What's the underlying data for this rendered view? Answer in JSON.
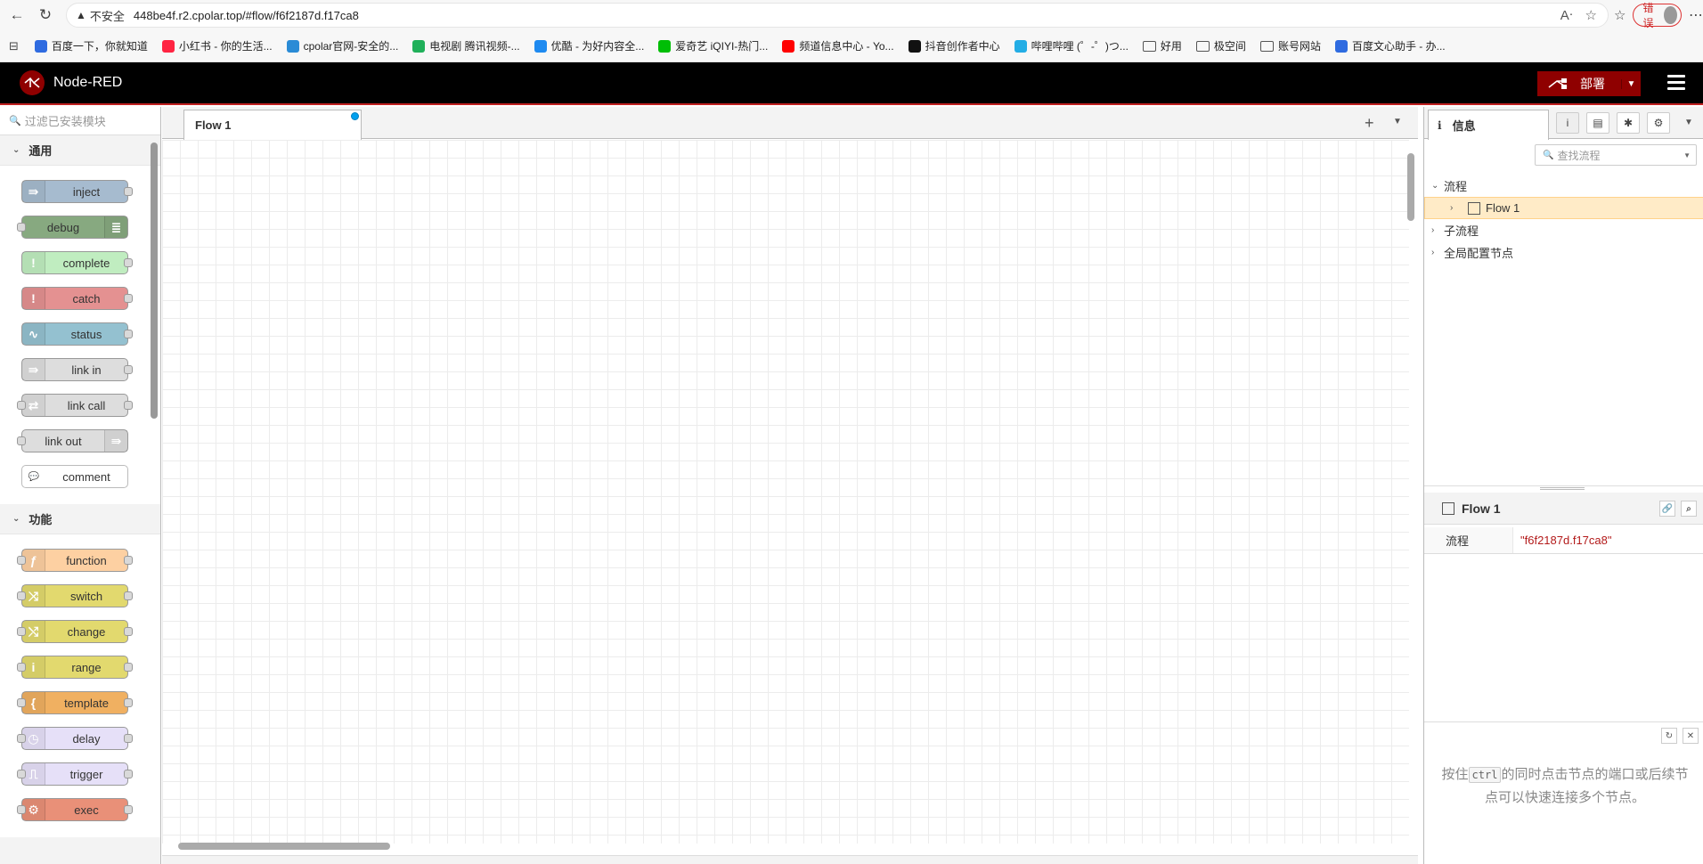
{
  "browser": {
    "insecure_label": "不安全",
    "url": "448be4f.r2.cpolar.top/#flow/f6f2187d.f17ca8",
    "error_label": "错误",
    "bookmarks": [
      {
        "label": "百度一下，你就知道",
        "color": "#2f6be0"
      },
      {
        "label": "小红书 - 你的生活...",
        "color": "#ff2442"
      },
      {
        "label": "cpolar官网-安全的...",
        "color": "#2a8bd6"
      },
      {
        "label": "电视剧 腾讯视频-...",
        "color": "#20b05a"
      },
      {
        "label": "优酷 - 为好内容全...",
        "color": "#1e8af0"
      },
      {
        "label": "爱奇艺 iQIYI-热门...",
        "color": "#00be06"
      },
      {
        "label": "频道信息中心 - Yo...",
        "color": "#ff0000"
      },
      {
        "label": "抖音创作者中心",
        "color": "#111111"
      },
      {
        "label": "哔哩哔哩 (゜-゜)つ...",
        "color": "#23ade5"
      },
      {
        "label": "好用",
        "folder": true
      },
      {
        "label": "极空间",
        "folder": true
      },
      {
        "label": "账号网站",
        "folder": true
      },
      {
        "label": "百度文心助手 - 办...",
        "color": "#2f6be0"
      }
    ]
  },
  "header": {
    "title": "Node-RED",
    "deploy_label": "部署"
  },
  "palette": {
    "search_placeholder": "过滤已安装模块",
    "categories": [
      {
        "name": "通用",
        "nodes": [
          {
            "label": "inject",
            "color": "#a6bbcf",
            "icon": "⇛",
            "in": false,
            "out": true,
            "icon_right": false
          },
          {
            "label": "debug",
            "color": "#87a980",
            "icon": "≣",
            "in": true,
            "out": false,
            "icon_right": true
          },
          {
            "label": "complete",
            "color": "#c0edc0",
            "icon": "!",
            "in": false,
            "out": true,
            "icon_right": false
          },
          {
            "label": "catch",
            "color": "#e49191",
            "icon": "!",
            "in": false,
            "out": true,
            "icon_right": false
          },
          {
            "label": "status",
            "color": "#94c1d0",
            "icon": "∿",
            "in": false,
            "out": true,
            "icon_right": false
          },
          {
            "label": "link in",
            "color": "#dddddd",
            "icon": "⇛",
            "in": false,
            "out": true,
            "icon_right": false
          },
          {
            "label": "link call",
            "color": "#dddddd",
            "icon": "⇄",
            "in": true,
            "out": true,
            "icon_right": false
          },
          {
            "label": "link out",
            "color": "#dddddd",
            "icon": "⇛",
            "in": true,
            "out": false,
            "icon_right": true
          },
          {
            "label": "comment",
            "color": "#ffffff",
            "icon": "💬",
            "in": false,
            "out": false,
            "icon_right": false
          }
        ]
      },
      {
        "name": "功能",
        "nodes": [
          {
            "label": "function",
            "color": "#fdd0a2",
            "icon": "ƒ",
            "in": true,
            "out": true,
            "icon_right": false
          },
          {
            "label": "switch",
            "color": "#e2d96e",
            "icon": "⤨",
            "in": true,
            "out": true,
            "icon_right": false
          },
          {
            "label": "change",
            "color": "#e2d96e",
            "icon": "⤭",
            "in": true,
            "out": true,
            "icon_right": false
          },
          {
            "label": "range",
            "color": "#e2d96e",
            "icon": "i",
            "in": true,
            "out": true,
            "icon_right": false
          },
          {
            "label": "template",
            "color": "#f0b061",
            "icon": "{",
            "in": true,
            "out": true,
            "icon_right": false
          },
          {
            "label": "delay",
            "color": "#e6e0f8",
            "icon": "◷",
            "in": true,
            "out": true,
            "icon_right": false
          },
          {
            "label": "trigger",
            "color": "#e6e0f8",
            "icon": "⎍",
            "in": true,
            "out": true,
            "icon_right": false
          },
          {
            "label": "exec",
            "color": "#e99078",
            "icon": "⚙",
            "in": true,
            "out": true,
            "icon_right": false
          }
        ]
      }
    ]
  },
  "workspace": {
    "tab_label": "Flow 1"
  },
  "sidebar": {
    "tab_label": "信息",
    "search_placeholder": "查找流程",
    "tree": {
      "flows_label": "流程",
      "flow_item": "Flow 1",
      "subflows_label": "子流程",
      "global_config_label": "全局配置节点"
    },
    "props": {
      "title": "Flow 1",
      "key": "流程",
      "value": "\"f6f2187d.f17ca8\""
    },
    "tip": {
      "before": "按住",
      "key": "ctrl",
      "after": "的同时点击节点的端口或后续节点可以快速连接多个节点。"
    }
  }
}
